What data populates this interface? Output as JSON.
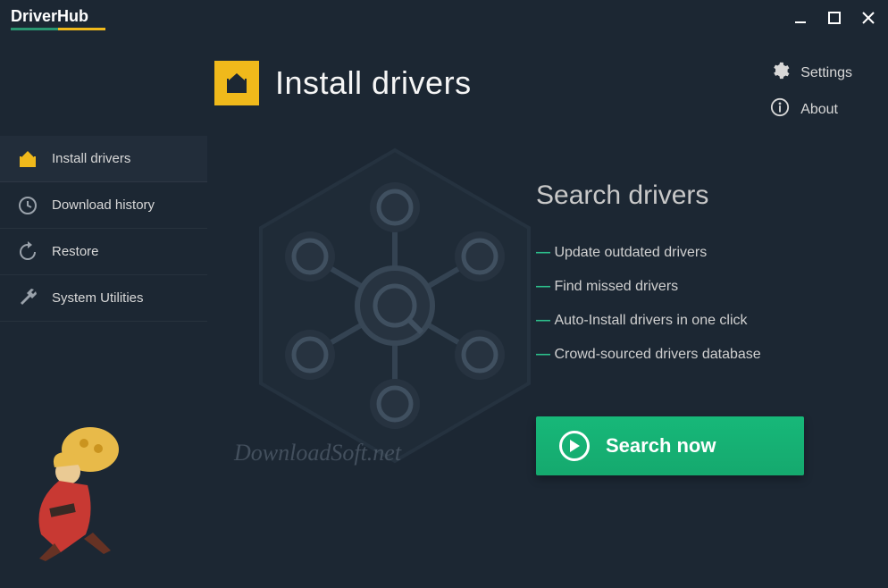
{
  "app": {
    "name": "DriverHub"
  },
  "page": {
    "title": "Install drivers"
  },
  "header_actions": {
    "settings": "Settings",
    "about": "About"
  },
  "sidebar": {
    "items": [
      {
        "label": "Install drivers"
      },
      {
        "label": "Download history"
      },
      {
        "label": "Restore"
      },
      {
        "label": "System Utilities"
      }
    ]
  },
  "panel": {
    "heading": "Search drivers",
    "features": [
      "Update outdated drivers",
      "Find missed drivers",
      "Auto-Install drivers in one click",
      "Crowd-sourced drivers database"
    ],
    "cta": "Search now"
  },
  "watermark": "DownloadSoft.net"
}
